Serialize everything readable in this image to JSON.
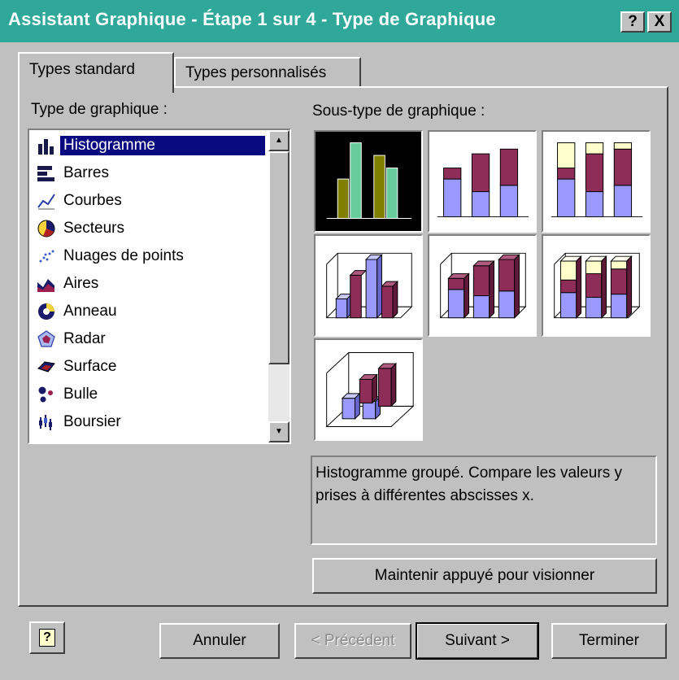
{
  "window": {
    "title": "Assistant Graphique - Étape 1 sur 4 - Type de Graphique",
    "help_btn": "?",
    "close_btn": "X"
  },
  "tabs": [
    {
      "label": "Types standard",
      "active": true
    },
    {
      "label": "Types personnalisés",
      "active": false
    }
  ],
  "chart_type": {
    "label": "Type de graphique :",
    "items": [
      {
        "label": "Histogramme",
        "icon": "column-chart-icon",
        "selected": true
      },
      {
        "label": "Barres",
        "icon": "bar-chart-icon"
      },
      {
        "label": "Courbes",
        "icon": "line-chart-icon"
      },
      {
        "label": "Secteurs",
        "icon": "pie-chart-icon"
      },
      {
        "label": "Nuages de points",
        "icon": "scatter-chart-icon"
      },
      {
        "label": "Aires",
        "icon": "area-chart-icon"
      },
      {
        "label": "Anneau",
        "icon": "doughnut-chart-icon"
      },
      {
        "label": "Radar",
        "icon": "radar-chart-icon"
      },
      {
        "label": "Surface",
        "icon": "surface-chart-icon"
      },
      {
        "label": "Bulle",
        "icon": "bubble-chart-icon"
      },
      {
        "label": "Boursier",
        "icon": "stock-chart-icon"
      }
    ]
  },
  "subtype": {
    "label": "Sous-type de graphique :",
    "options": [
      {
        "name": "clustered-column",
        "selected": true
      },
      {
        "name": "stacked-column"
      },
      {
        "name": "100-stacked-column"
      },
      {
        "name": "3d-clustered-column"
      },
      {
        "name": "3d-stacked-column"
      },
      {
        "name": "3d-100-stacked-column"
      },
      {
        "name": "3d-column"
      }
    ],
    "description": "Histogramme groupé. Compare les valeurs y prises à différentes abscisses x."
  },
  "buttons": {
    "preview": "Maintenir appuyé pour visionner",
    "help": "?",
    "cancel": "Annuler",
    "previous": "< Précédent",
    "next": "Suivant >",
    "finish": "Terminer"
  },
  "colors": {
    "title_bar": "#2fa89a",
    "selection": "#0a0a80",
    "series_purple": "#8e2d58",
    "series_blue": "#9999ff",
    "series_cream": "#ffffcc",
    "selected_olive": "#808000",
    "selected_teal": "#66cc99"
  }
}
